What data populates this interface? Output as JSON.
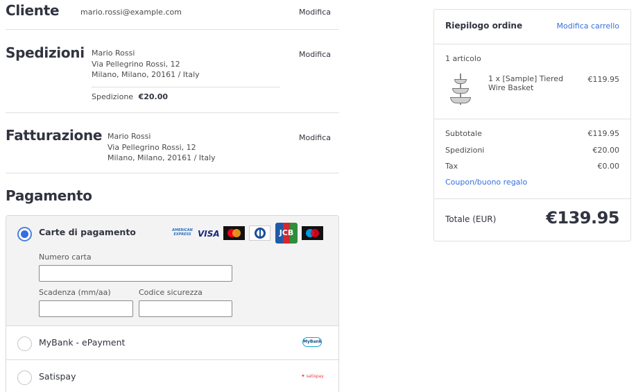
{
  "customer": {
    "title": "Cliente",
    "email": "mario.rossi@example.com",
    "edit_label": "Modifica"
  },
  "shipping": {
    "title": "Spedizioni",
    "address": [
      "Mario Rossi",
      "Via Pellegrino Rossi, 12",
      "Milano, Milano, 20161 / Italy"
    ],
    "method_label": "Spedizione",
    "method_price": "€20.00",
    "edit_label": "Modifica"
  },
  "billing": {
    "title": "Fatturazione",
    "address": [
      "Mario Rossi",
      "Via Pellegrino Rossi, 12",
      "Milano, Milano, 20161 / Italy"
    ],
    "edit_label": "Modifica"
  },
  "payment": {
    "title": "Pagamento",
    "options": [
      {
        "label": "Carte di pagamento",
        "selected": true,
        "card_icons": [
          "amex-icon",
          "visa-icon",
          "mastercard-icon",
          "diners-icon",
          "jcb-icon",
          "maestro-icon"
        ],
        "card_icon_texts": {
          "amex": "AMERICAN EXPRESS",
          "visa": "VISA",
          "jcb": "JCB"
        },
        "fields": {
          "card_number_label": "Numero carta",
          "card_number_value": "",
          "expiry_label": "Scadenza (mm/aa)",
          "expiry_value": "",
          "cvv_label": "Codice sicurezza",
          "cvv_value": ""
        }
      },
      {
        "label": "MyBank - ePayment",
        "selected": false,
        "logo": "mybank-logo",
        "logo_text": "MyBank"
      },
      {
        "label": "Satispay",
        "selected": false,
        "logo": "satispay-logo",
        "logo_text": "satispay"
      }
    ]
  },
  "summary": {
    "title": "Riepilogo ordine",
    "edit_cart_label": "Modifica carrello",
    "item_count": "1 articolo",
    "items": [
      {
        "name": "1 x [Sample] Tiered Wire Basket",
        "price": "€119.95",
        "image": "tiered-wire-basket-image"
      }
    ],
    "subtotal_label": "Subtotale",
    "subtotal": "€119.95",
    "shipping_label": "Spedizioni",
    "shipping": "€20.00",
    "tax_label": "Tax",
    "tax": "€0.00",
    "coupon_label": "Coupon/buono regalo",
    "total_label": "Totale (EUR)",
    "total": "€139.95"
  },
  "colors": {
    "accent": "#3470dd",
    "text": "#313440",
    "border": "#dfdfdf",
    "payment_selected_bg": "#f3f3f3"
  }
}
